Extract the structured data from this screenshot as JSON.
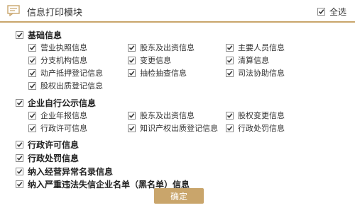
{
  "header": {
    "title": "信息打印模块",
    "select_all_label": "全选"
  },
  "sections": [
    {
      "title": "基础信息",
      "items": [
        "营业执照信息",
        "股东及出资信息",
        "主要人员信息",
        "分支机构信息",
        "变更信息",
        "清算信息",
        "动产抵押登记信息",
        "抽检抽查信息",
        "司法协助信息",
        "股权出质登记信息"
      ]
    },
    {
      "title": "企业自行公示信息",
      "items": [
        "企业年报信息",
        "股东及出资信息",
        "股权变更信息",
        "行政许可信息",
        "知识产权出质登记信息",
        "行政处罚信息"
      ]
    },
    {
      "title": "行政许可信息",
      "items": []
    },
    {
      "title": "行政处罚信息",
      "items": []
    },
    {
      "title": "纳入经营异常名录信息",
      "items": []
    },
    {
      "title": "纳入严重违法失信企业名单（黑名单）信息",
      "items": []
    }
  ],
  "footer": {
    "confirm_label": "确定"
  },
  "colors": {
    "accent": "#c9a56b",
    "check": "#333333"
  }
}
